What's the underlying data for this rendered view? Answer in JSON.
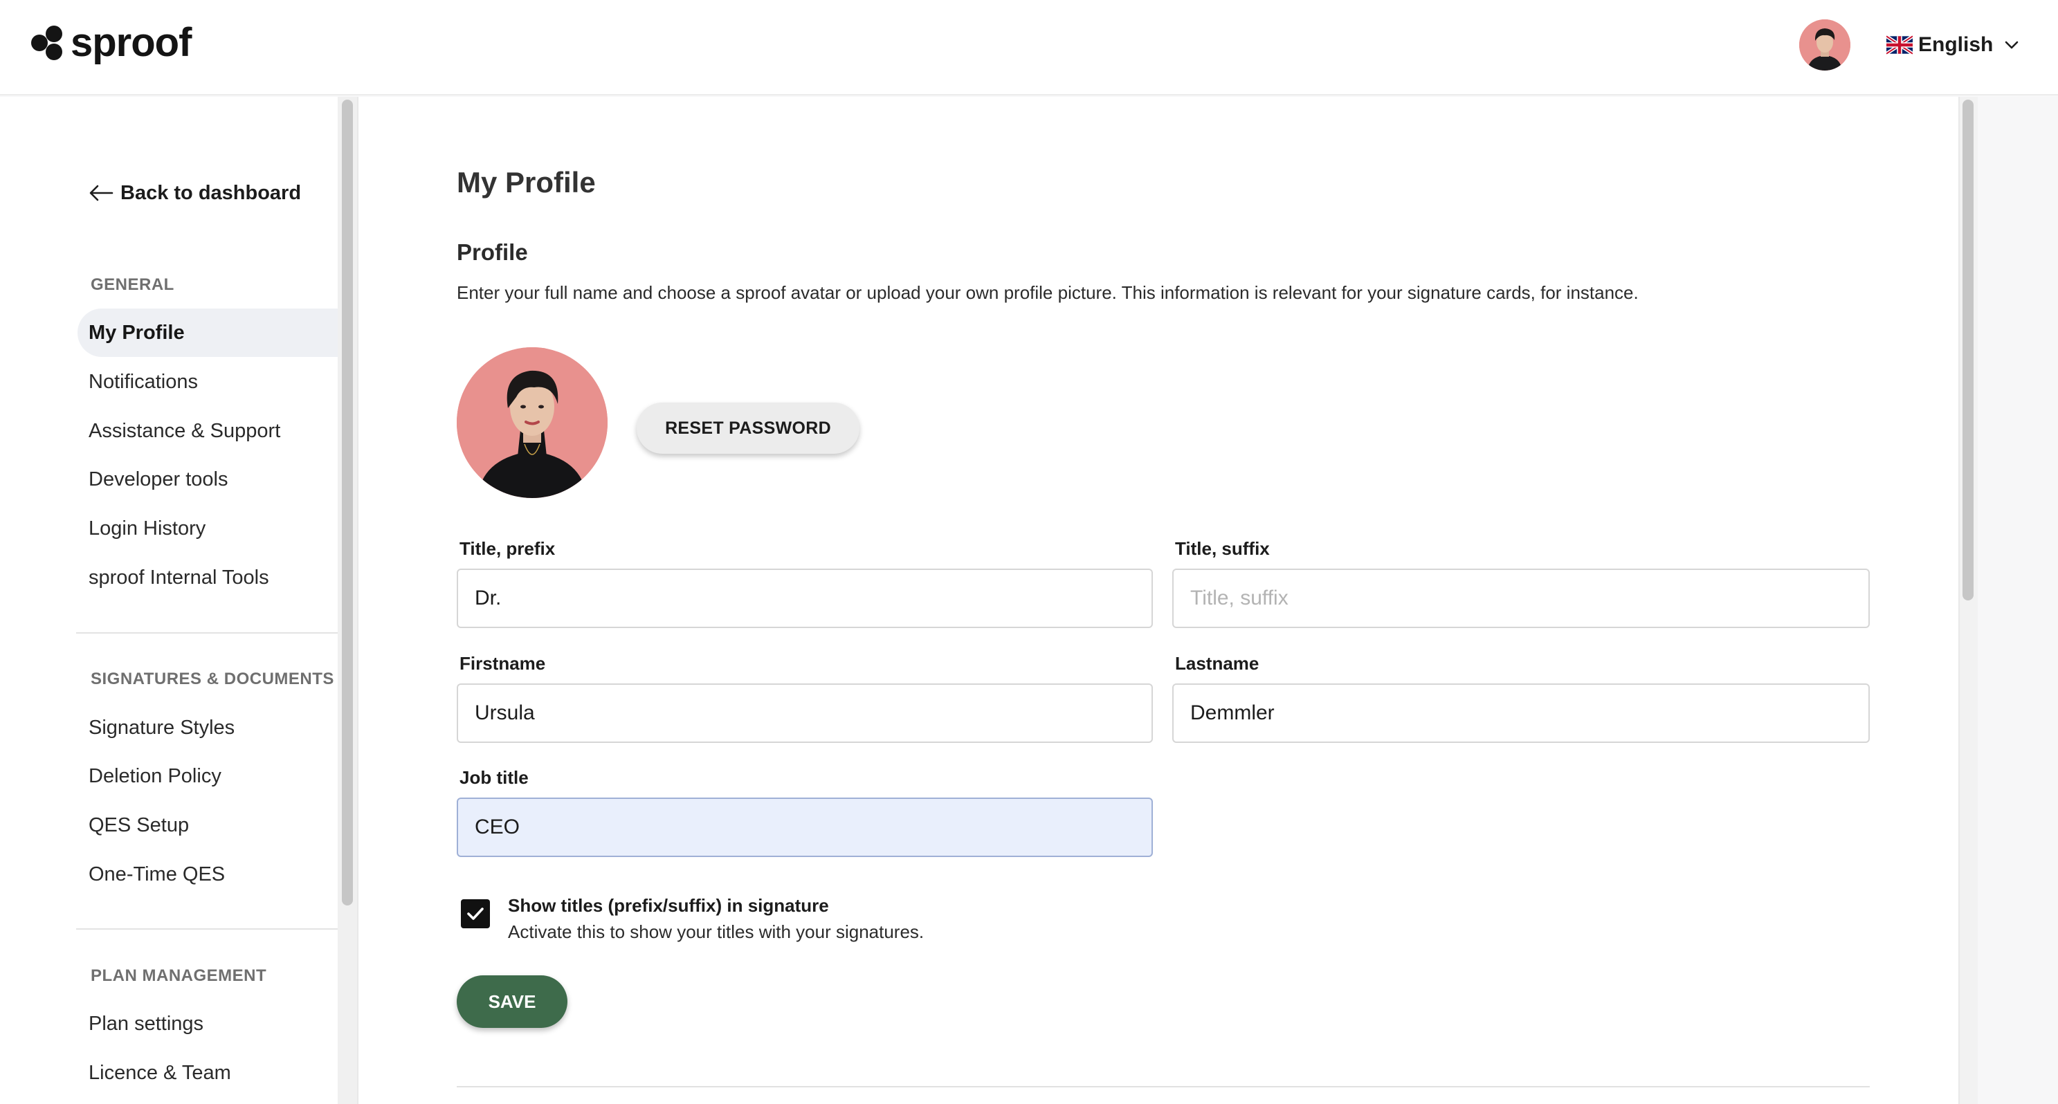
{
  "header": {
    "brand": "sproof",
    "language": "English"
  },
  "sidebar": {
    "back_label": "Back to dashboard",
    "sections": [
      {
        "title": "GENERAL",
        "items": [
          "My Profile",
          "Notifications",
          "Assistance & Support",
          "Developer tools",
          "Login History",
          "sproof Internal Tools"
        ]
      },
      {
        "title": "SIGNATURES & DOCUMENTS",
        "items": [
          "Signature Styles",
          "Deletion Policy",
          "QES Setup",
          "One-Time QES"
        ]
      },
      {
        "title": "PLAN MANAGEMENT",
        "items": [
          "Plan settings",
          "Licence & Team"
        ]
      }
    ],
    "active_item": "My Profile"
  },
  "main": {
    "page_title": "My Profile",
    "section_title": "Profile",
    "section_description": "Enter your full name and choose a sproof avatar or upload your own profile picture. This information is relevant for your signature cards, for instance.",
    "reset_password_label": "RESET PASSWORD",
    "fields": {
      "title_prefix": {
        "label": "Title, prefix",
        "value": "Dr.",
        "placeholder": ""
      },
      "title_suffix": {
        "label": "Title, suffix",
        "value": "",
        "placeholder": "Title, suffix"
      },
      "firstname": {
        "label": "Firstname",
        "value": "Ursula",
        "placeholder": ""
      },
      "lastname": {
        "label": "Lastname",
        "value": "Demmler",
        "placeholder": ""
      },
      "job_title": {
        "label": "Job title",
        "value": "CEO",
        "placeholder": ""
      }
    },
    "show_titles": {
      "checked": true,
      "label": "Show titles (prefix/suffix) in signature",
      "description": "Activate this to show your titles with your signatures."
    },
    "save_label": "SAVE"
  },
  "colors": {
    "accent_green": "#3e6b4b",
    "avatar_bg": "#e8918e",
    "active_nav_bg": "#eef0f4",
    "focused_input_bg": "#e9effc"
  },
  "icons": {
    "logo": "sproof-hexagon-logo-icon",
    "back": "arrow-left-icon",
    "language_flag": "uk-flag-icon",
    "language_caret": "chevron-down-icon",
    "checkbox": "checkmark-icon"
  }
}
